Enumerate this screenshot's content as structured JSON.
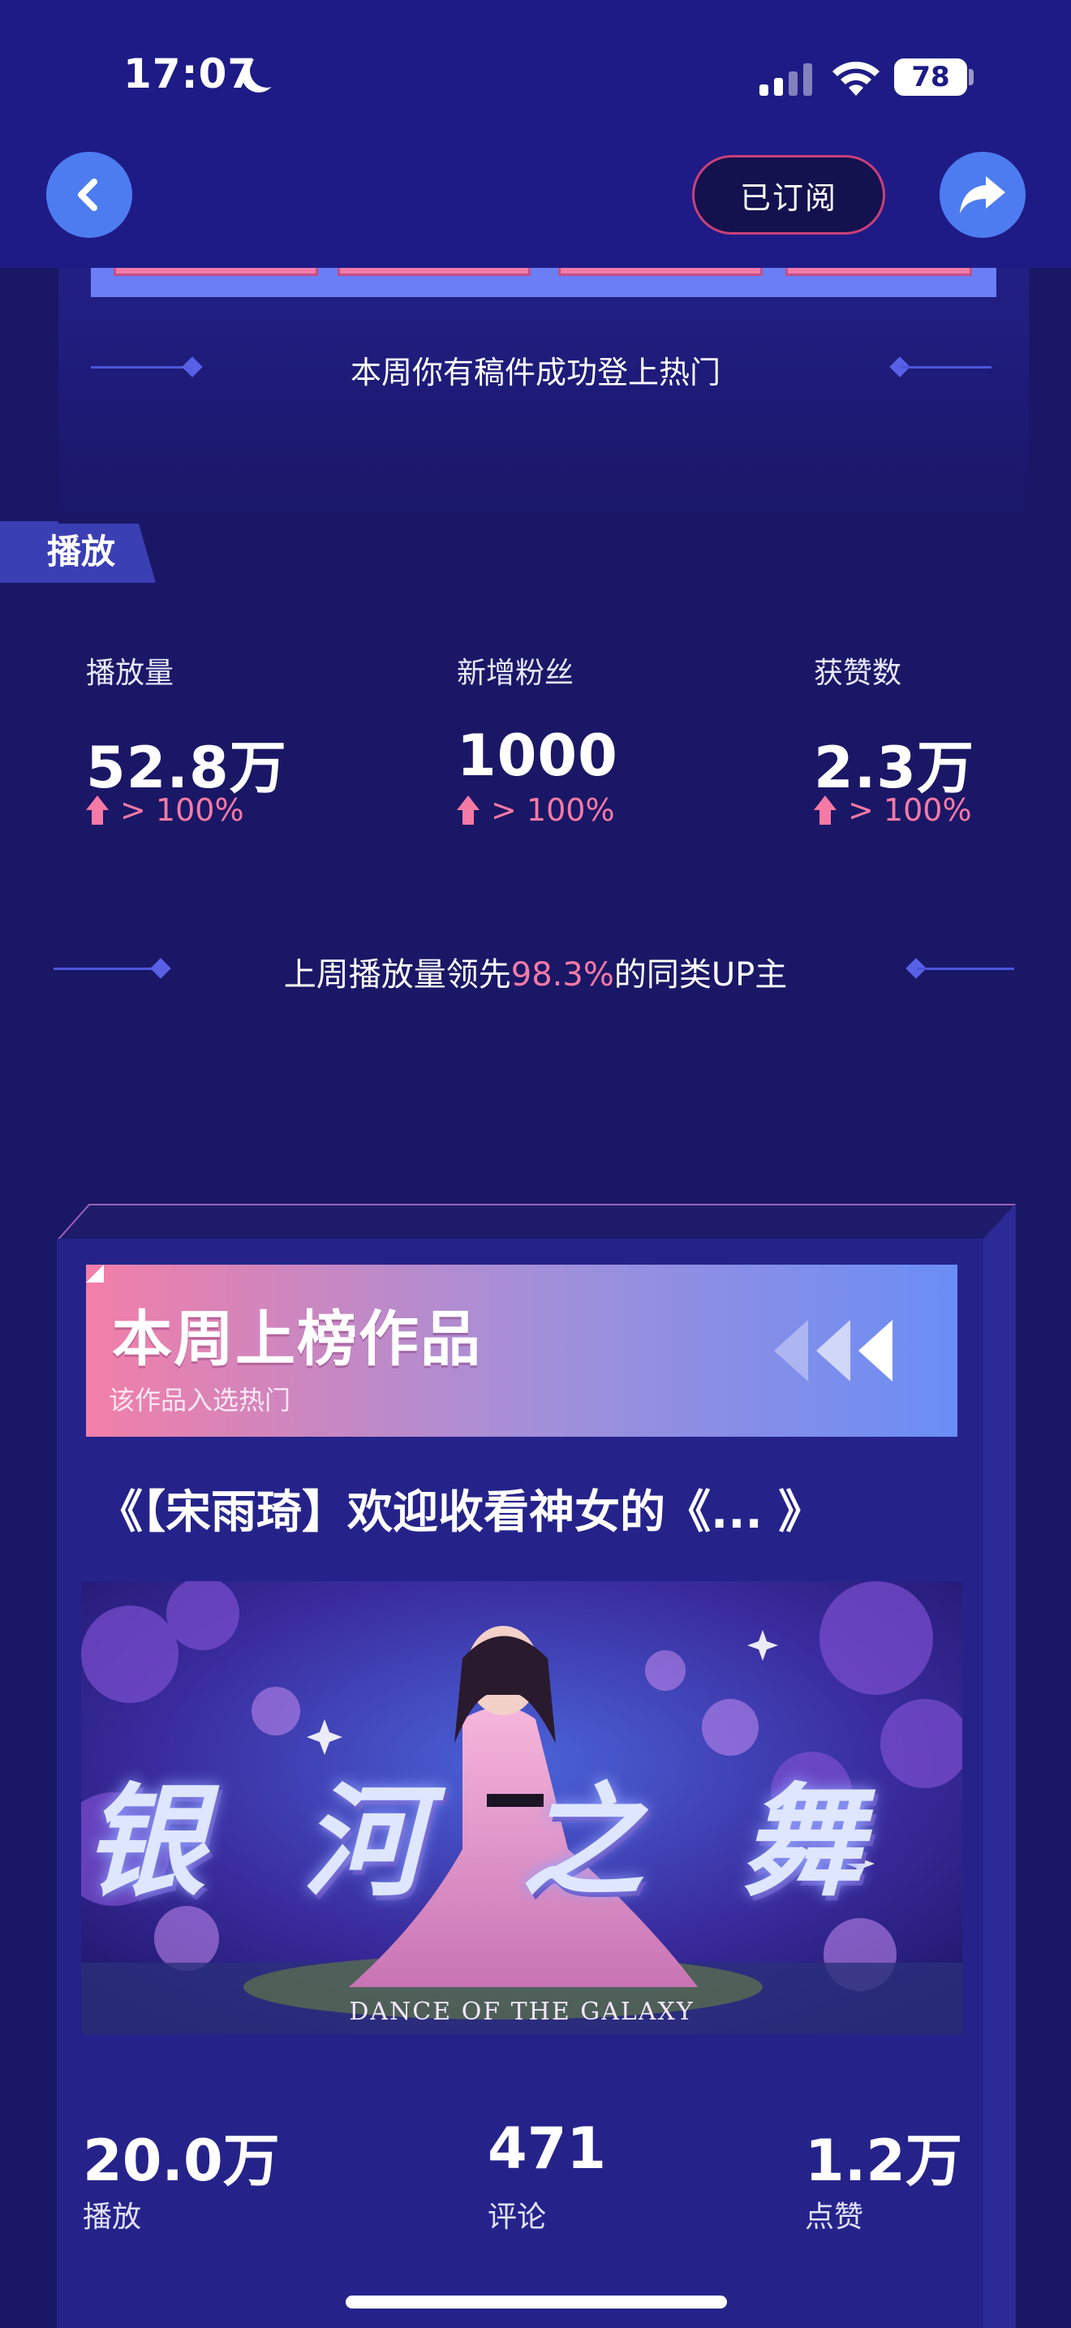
{
  "status_bar": {
    "time": "17:07",
    "battery": "78"
  },
  "nav": {
    "subscribed_label": "已订阅"
  },
  "hot_banner": {
    "text": "本周你有稿件成功登上热门"
  },
  "play_section": {
    "tab_label": "播放",
    "stats": [
      {
        "label": "播放量",
        "value": "52.8万",
        "change": "> 100%"
      },
      {
        "label": "新增粉丝",
        "value": "1000",
        "change": "> 100%"
      },
      {
        "label": "获赞数",
        "value": "2.3万",
        "change": "> 100%"
      }
    ],
    "lead_prefix": "上周播放量领先",
    "lead_percent": "98.3%",
    "lead_suffix": "的同类UP主"
  },
  "ranked_work": {
    "banner_title": "本周上榜作品",
    "banner_subtitle": "该作品入选热门",
    "title": "《【宋雨琦】欢迎收看神女的《... 》",
    "thumbnail_title": "银河之舞",
    "thumbnail_caption": "DANCE OF THE GALAXY",
    "stats": [
      {
        "value": "20.0万",
        "label": "播放"
      },
      {
        "value": "471",
        "label": "评论"
      },
      {
        "value": "1.2万",
        "label": "点赞"
      }
    ]
  },
  "colors": {
    "background": "#1a1766",
    "nav_bar": "#1e1b86",
    "accent_blue": "#4d7cf0",
    "accent_pink": "#f57aa6"
  },
  "icons": [
    "moon-icon",
    "signal-icon",
    "wifi-icon",
    "battery-icon",
    "back-arrow-icon",
    "share-icon",
    "up-arrow-icon",
    "chevron-left-icon"
  ]
}
